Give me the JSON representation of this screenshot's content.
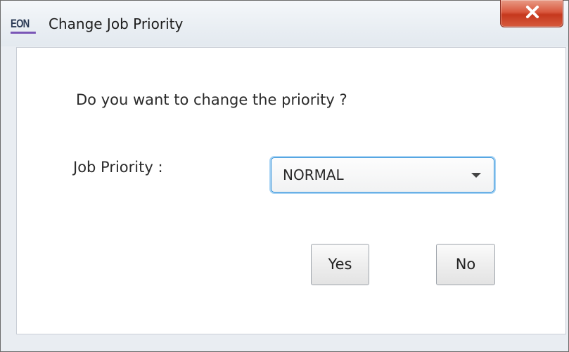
{
  "window": {
    "title": "Change Job Priority",
    "app_logo_text": "EON",
    "close_icon": "close-icon",
    "accent_color": "#7a56b6",
    "close_button_color": "#c5381d"
  },
  "dialog": {
    "question": "Do you want to change the priority ?",
    "priority_label": "Job Priority :",
    "priority_select": {
      "selected": "NORMAL",
      "icon": "chevron-down-icon",
      "focus_color": "#2f8fd8"
    },
    "buttons": {
      "yes_label": "Yes",
      "no_label": "No"
    }
  }
}
